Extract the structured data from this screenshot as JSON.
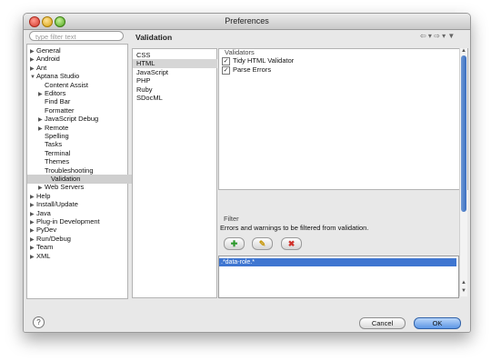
{
  "window": {
    "title": "Preferences"
  },
  "filter": {
    "placeholder": "type filter text"
  },
  "tree": [
    {
      "label": "General",
      "arrow": "▶"
    },
    {
      "label": "Android",
      "arrow": "▶"
    },
    {
      "label": "Ant",
      "arrow": "▶"
    },
    {
      "label": "Aptana Studio",
      "arrow": "▼"
    },
    {
      "label": "Content Assist",
      "arrow": ""
    },
    {
      "label": "Editors",
      "arrow": "▶"
    },
    {
      "label": "Find Bar",
      "arrow": ""
    },
    {
      "label": "Formatter",
      "arrow": ""
    },
    {
      "label": "JavaScript Debug",
      "arrow": "▶"
    },
    {
      "label": "Remote",
      "arrow": "▶"
    },
    {
      "label": "Spelling",
      "arrow": ""
    },
    {
      "label": "Tasks",
      "arrow": ""
    },
    {
      "label": "Terminal",
      "arrow": ""
    },
    {
      "label": "Themes",
      "arrow": ""
    },
    {
      "label": "Troubleshooting",
      "arrow": ""
    },
    {
      "label": "Validation",
      "arrow": "",
      "selected": true
    },
    {
      "label": "Web Servers",
      "arrow": "▶"
    },
    {
      "label": "Help",
      "arrow": "▶"
    },
    {
      "label": "Install/Update",
      "arrow": "▶"
    },
    {
      "label": "Java",
      "arrow": "▶"
    },
    {
      "label": "Plug-in Development",
      "arrow": "▶"
    },
    {
      "label": "PyDev",
      "arrow": "▶"
    },
    {
      "label": "Run/Debug",
      "arrow": "▶"
    },
    {
      "label": "Team",
      "arrow": "▶"
    },
    {
      "label": "XML",
      "arrow": "▶"
    }
  ],
  "page": {
    "title": "Validation",
    "nav": "⇦ ▾ ⇨ ▾ ▼"
  },
  "languages": [
    "CSS",
    "HTML",
    "JavaScript",
    "PHP",
    "Ruby",
    "SDocML"
  ],
  "selected_language": "HTML",
  "validators": {
    "label": "Validators",
    "items": [
      {
        "label": "Tidy HTML Validator",
        "checked": true
      },
      {
        "label": "Parse Errors",
        "checked": true
      }
    ]
  },
  "filter_section": {
    "label": "Filter",
    "description": "Errors and warnings to be filtered from validation.",
    "items": [
      ".*data-role.*"
    ],
    "add_symbol": "✚",
    "edit_symbol": "✎",
    "remove_symbol": "✖"
  },
  "buttons": {
    "help": "?",
    "cancel": "Cancel",
    "ok": "OK"
  },
  "colors": {
    "selection": "#3f76d1",
    "add": "#2e9a2e",
    "edit": "#c89a10",
    "remove": "#d0302a"
  }
}
